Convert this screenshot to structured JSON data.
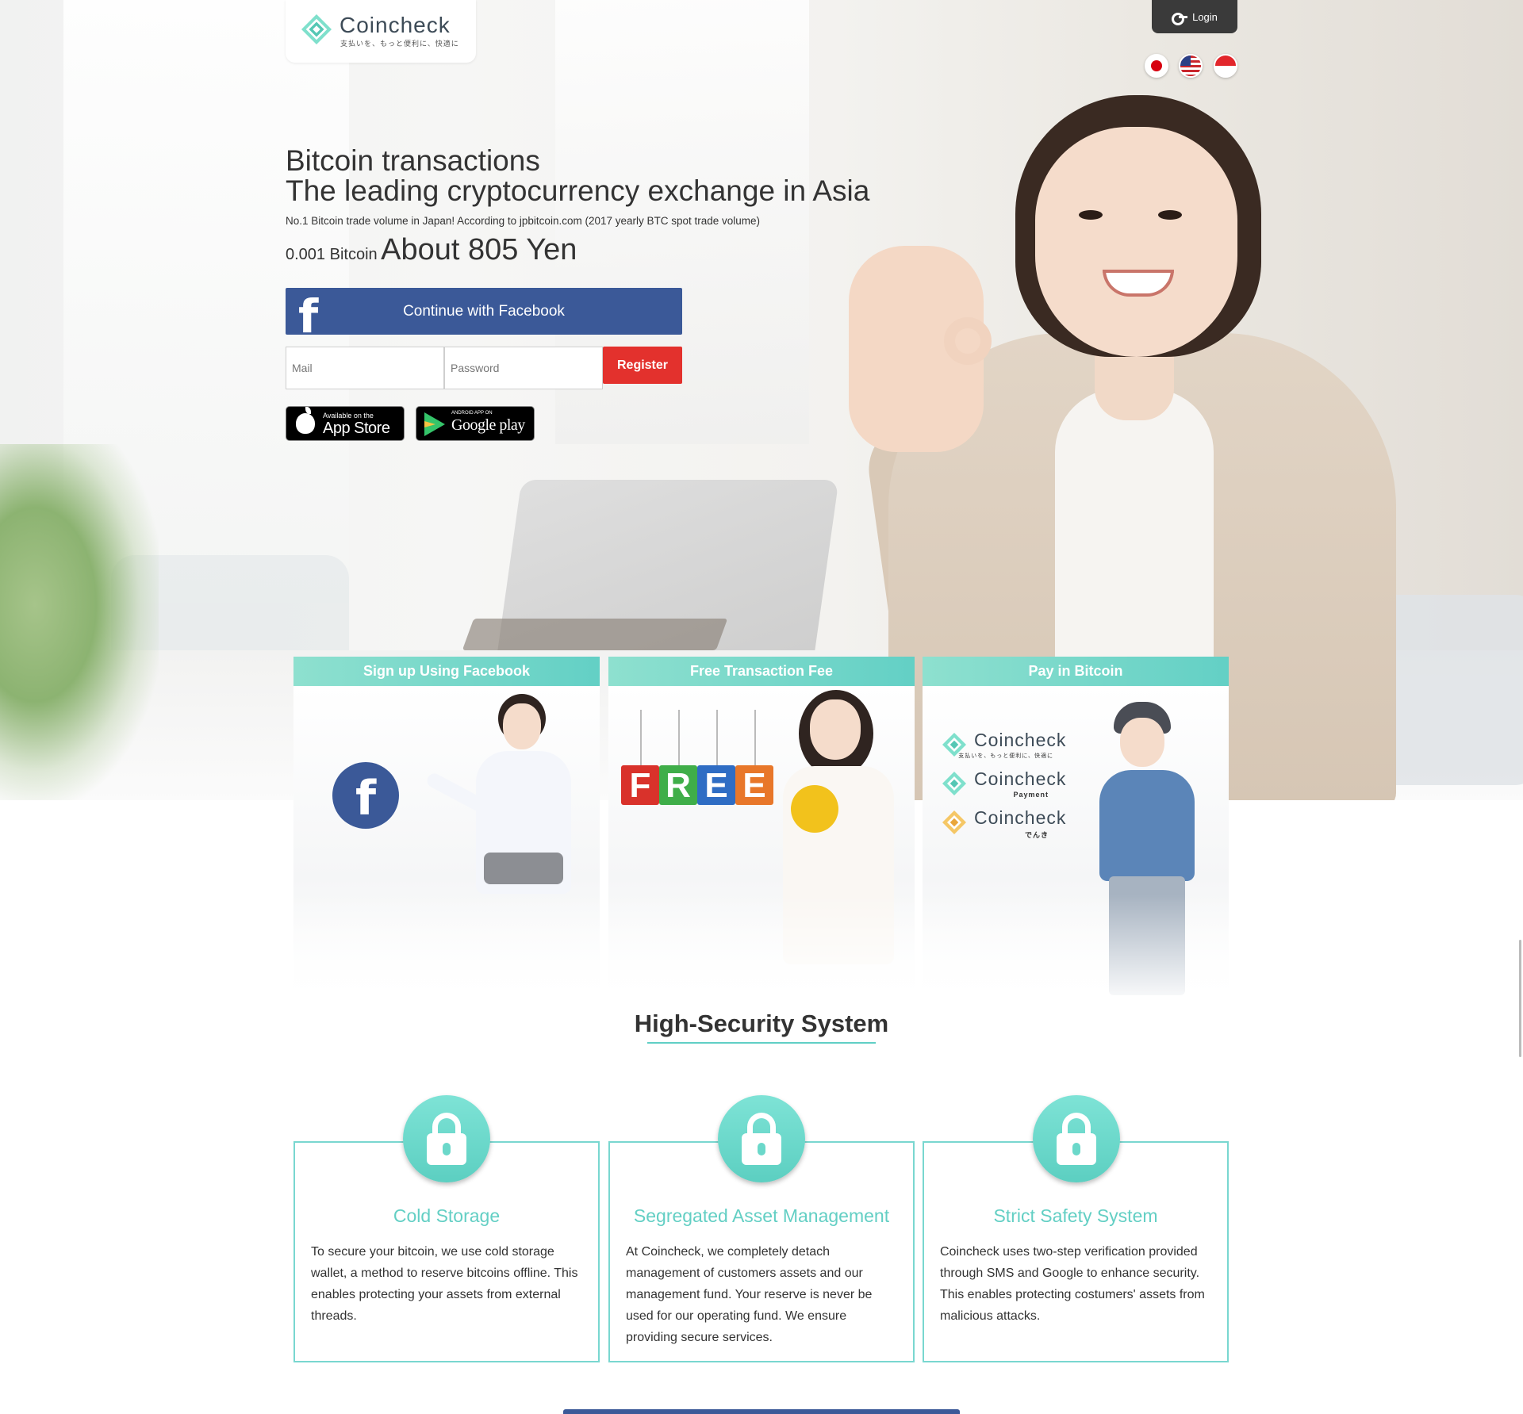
{
  "header": {
    "brand_name": "Coincheck",
    "brand_tagline": "支払いを、もっと便利に、快適に",
    "login_label": "Login",
    "languages": [
      "Japanese",
      "English",
      "Indonesian"
    ]
  },
  "hero": {
    "title_line1": "Bitcoin transactions",
    "title_line2": "The leading cryptocurrency exchange in Asia",
    "subtitle": "No.1 Bitcoin trade volume in Japan! According to jpbitcoin.com (2017 yearly BTC spot trade volume)",
    "price_amount": "0.001 Bitcoin",
    "price_value": "About 805 Yen",
    "facebook_button": "Continue with Facebook",
    "mail_placeholder": "Mail",
    "password_placeholder": "Password",
    "register_button": "Register",
    "appstore_small": "Available on the",
    "appstore_big": "App Store",
    "googleplay_small": "ANDROID APP ON",
    "googleplay_big": "Google play"
  },
  "features": [
    {
      "title": "Sign up Using Facebook"
    },
    {
      "title": "Free Transaction Fee",
      "letters": [
        "F",
        "R",
        "E",
        "E"
      ]
    },
    {
      "title": "Pay in Bitcoin",
      "brands": [
        {
          "name": "Coincheck",
          "sub": "支払いを、もっと便利に、快適に"
        },
        {
          "name": "Coincheck",
          "sub": "Payment"
        },
        {
          "name": "Coincheck",
          "sub": "でんき"
        }
      ]
    }
  ],
  "security": {
    "title": "High-Security System",
    "cards": [
      {
        "name": "Cold Storage",
        "text": "To secure your bitcoin, we use cold storage wallet, a method to reserve bitcoins offline. This enables protecting your assets from external threads."
      },
      {
        "name": "Segregated Asset Management",
        "text": "At Coincheck, we completely detach management of customers assets and our management fund. Your reserve is never be used for our operating fund. We ensure providing secure services."
      },
      {
        "name": "Strict Safety System",
        "text": "Coincheck uses two-step verification provided through SMS and Google to enhance security. This enables protecting costumers' assets from malicious attacks."
      }
    ]
  },
  "colors": {
    "accent": "#63cfc4",
    "facebook": "#3b5998",
    "register": "#e3312d"
  }
}
